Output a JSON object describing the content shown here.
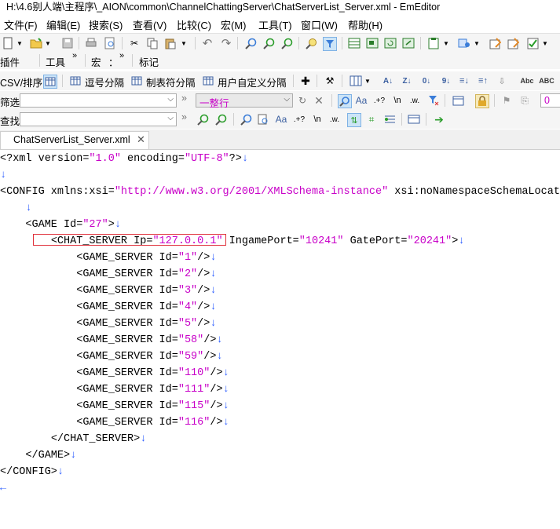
{
  "window": {
    "title": "H:\\4.6别人端\\主程序\\_AION\\common\\ChannelChattingServer\\ChatServerList_Server.xml - EmEditor"
  },
  "menu": [
    "文件(F)",
    "编辑(E)",
    "搜索(S)",
    "查看(V)",
    "比较(C)",
    "宏(M)",
    "工具(T)",
    "窗口(W)",
    "帮助(H)"
  ],
  "toolbar2": {
    "plugins": "插件",
    "tools": "工具",
    "macro": "宏",
    "macro_sep": "：",
    "marks": "标记"
  },
  "toolbar3": {
    "csv": "CSV/排序",
    "comma": "逗号分隔",
    "tab": "制表符分隔",
    "custom": "用户自定义分隔"
  },
  "filter": {
    "label": "筛选",
    "value": "",
    "mode": "一整行",
    "number": "0"
  },
  "find": {
    "label": "查找",
    "value": ""
  },
  "tab": {
    "filename": "ChatServerList_Server.xml"
  },
  "editor_lines": [
    {
      "indent": "",
      "parts": [
        [
          "t",
          "<?xml version="
        ],
        [
          "v",
          "\"1.0\""
        ],
        [
          "t",
          " encoding="
        ],
        [
          "v",
          "\"UTF-8\""
        ],
        [
          "t",
          "?>"
        ],
        [
          "n",
          "↓"
        ]
      ]
    },
    {
      "indent": "",
      "parts": [
        [
          "n",
          "↓"
        ]
      ]
    },
    {
      "indent": "",
      "parts": [
        [
          "t",
          "<CONFIG xmlns:xsi="
        ],
        [
          "v",
          "\"http://www.w3.org/2001/XMLSchema-instance\""
        ],
        [
          "t",
          " xsi:noNamespaceSchemaLocati"
        ]
      ]
    },
    {
      "indent": "    ",
      "parts": [
        [
          "n",
          "↓"
        ]
      ]
    },
    {
      "indent": "    ",
      "parts": [
        [
          "t",
          "<GAME Id="
        ],
        [
          "v",
          "\"27\""
        ],
        [
          "t",
          ">"
        ],
        [
          "n",
          "↓"
        ]
      ]
    },
    {
      "indent": "        ",
      "parts": [
        [
          "t",
          "<CHAT_SERVER Ip="
        ],
        [
          "v",
          "\"127.0.0.1\""
        ],
        [
          "t",
          " IngamePort="
        ],
        [
          "v",
          "\"10241\""
        ],
        [
          "t",
          " GatePort="
        ],
        [
          "v",
          "\"20241\""
        ],
        [
          "t",
          ">"
        ],
        [
          "n",
          "↓"
        ]
      ]
    },
    {
      "indent": "            ",
      "parts": [
        [
          "t",
          "<GAME_SERVER Id="
        ],
        [
          "v",
          "\"1\""
        ],
        [
          "t",
          "/>"
        ],
        [
          "n",
          "↓"
        ]
      ]
    },
    {
      "indent": "            ",
      "parts": [
        [
          "t",
          "<GAME_SERVER Id="
        ],
        [
          "v",
          "\"2\""
        ],
        [
          "t",
          "/>"
        ],
        [
          "n",
          "↓"
        ]
      ]
    },
    {
      "indent": "            ",
      "parts": [
        [
          "t",
          "<GAME_SERVER Id="
        ],
        [
          "v",
          "\"3\""
        ],
        [
          "t",
          "/>"
        ],
        [
          "n",
          "↓"
        ]
      ]
    },
    {
      "indent": "            ",
      "parts": [
        [
          "t",
          "<GAME_SERVER Id="
        ],
        [
          "v",
          "\"4\""
        ],
        [
          "t",
          "/>"
        ],
        [
          "n",
          "↓"
        ]
      ]
    },
    {
      "indent": "            ",
      "parts": [
        [
          "t",
          "<GAME_SERVER Id="
        ],
        [
          "v",
          "\"5\""
        ],
        [
          "t",
          "/>"
        ],
        [
          "n",
          "↓"
        ]
      ]
    },
    {
      "indent": "            ",
      "parts": [
        [
          "t",
          "<GAME_SERVER Id="
        ],
        [
          "v",
          "\"58\""
        ],
        [
          "t",
          "/>"
        ],
        [
          "n",
          "↓"
        ]
      ]
    },
    {
      "indent": "            ",
      "parts": [
        [
          "t",
          "<GAME_SERVER Id="
        ],
        [
          "v",
          "\"59\""
        ],
        [
          "t",
          "/>"
        ],
        [
          "n",
          "↓"
        ]
      ]
    },
    {
      "indent": "            ",
      "parts": [
        [
          "t",
          "<GAME_SERVER Id="
        ],
        [
          "v",
          "\"110\""
        ],
        [
          "t",
          "/>"
        ],
        [
          "n",
          "↓"
        ]
      ]
    },
    {
      "indent": "            ",
      "parts": [
        [
          "t",
          "<GAME_SERVER Id="
        ],
        [
          "v",
          "\"111\""
        ],
        [
          "t",
          "/>"
        ],
        [
          "n",
          "↓"
        ]
      ]
    },
    {
      "indent": "            ",
      "parts": [
        [
          "t",
          "<GAME_SERVER Id="
        ],
        [
          "v",
          "\"115\""
        ],
        [
          "t",
          "/>"
        ],
        [
          "n",
          "↓"
        ]
      ]
    },
    {
      "indent": "            ",
      "parts": [
        [
          "t",
          "<GAME_SERVER Id="
        ],
        [
          "v",
          "\"116\""
        ],
        [
          "t",
          "/>"
        ],
        [
          "n",
          "↓"
        ]
      ]
    },
    {
      "indent": "        ",
      "parts": [
        [
          "t",
          "</CHAT_SERVER>"
        ],
        [
          "n",
          "↓"
        ]
      ]
    },
    {
      "indent": "    ",
      "parts": [
        [
          "t",
          "</GAME>"
        ],
        [
          "n",
          "↓"
        ]
      ]
    },
    {
      "indent": "",
      "parts": [
        [
          "t",
          "</CONFIG>"
        ],
        [
          "n",
          "↓"
        ]
      ]
    },
    {
      "indent": "",
      "parts": [
        [
          "n",
          "←"
        ]
      ]
    }
  ]
}
